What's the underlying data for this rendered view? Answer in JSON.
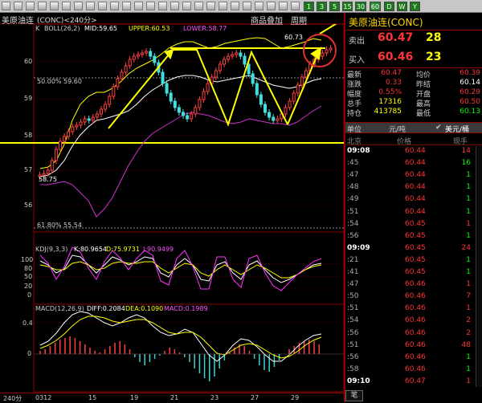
{
  "toolbar": {
    "period_buttons": [
      "1",
      "3",
      "5",
      "15",
      "30",
      "60",
      "D",
      "W",
      "Y"
    ]
  },
  "chart_header": {
    "symbol": "美原油连",
    "code_period": "(CONC)<240分>",
    "tab_overlay": "商品叠加",
    "tab_period": "周期"
  },
  "boll": {
    "label": "BOLL(26,2)",
    "prefix": "K",
    "mid": "MID:59.65",
    "upper": "UPPER:60.53",
    "lower": "LOWER:58.77",
    "colors": {
      "mid": "#ffffff",
      "upper": "#ffff00",
      "lower": "#ff55ff"
    }
  },
  "price_axis": [
    "60",
    "59",
    "58",
    "57",
    "56"
  ],
  "annotations": {
    "high": "60.73",
    "low": "58.75",
    "fib_50": "50.00% 59.60",
    "fib_618": "61.80% 55.54"
  },
  "kdj": {
    "label": "KDJ(9,3,3)",
    "k": "K:80.9654",
    "d": "D:75.9731",
    "j": "J:90.9499",
    "axis": [
      "100",
      "80",
      "50",
      "20",
      "0"
    ]
  },
  "macd": {
    "label": "MACD(12,26,9)",
    "diff": "DIFF:0.2084",
    "dea": "DEA:0.1090",
    "macd": "MACD:0.1989",
    "axis": [
      "0.4",
      "0"
    ]
  },
  "date_axis": {
    "period_label": "240分",
    "dates": [
      "0312",
      "15",
      "19",
      "21",
      "23",
      "27",
      "29"
    ]
  },
  "quote": {
    "title": "美原油连(CONC)",
    "ask_label": "卖出",
    "ask_price": "60.47",
    "ask_vol": "28",
    "bid_label": "买入",
    "bid_price": "60.46",
    "bid_vol": "23",
    "rows": [
      {
        "l1": "最新",
        "v1": "60.47",
        "c1": "#ff3333",
        "l2": "均价",
        "v2": "60.39",
        "c2": "#ff3333"
      },
      {
        "l1": "涨跌",
        "v1": "0.33",
        "c1": "#ff3333",
        "l2": "昨结",
        "v2": "60.14",
        "c2": "#ffffff"
      },
      {
        "l1": "幅度",
        "v1": "0.55%",
        "c1": "#ff3333",
        "l2": "开盘",
        "v2": "60.29",
        "c2": "#ff3333"
      },
      {
        "l1": "总手",
        "v1": "17316",
        "c1": "#ffff00",
        "l2": "最高",
        "v2": "60.50",
        "c2": "#ff3333"
      },
      {
        "l1": "持仓",
        "v1": "413785",
        "c1": "#ffff00",
        "l2": "最低",
        "v2": "60.13",
        "c2": "#00ff00"
      }
    ]
  },
  "unit_bar": {
    "label": "单位",
    "unit1": "元/吨",
    "unit2": "美元/桶"
  },
  "ticks": {
    "headers": [
      "北京",
      "价格",
      "现手"
    ],
    "rows": [
      {
        "time": "09:08",
        "price": "60.44",
        "vol": "14",
        "vc": "#ff3333",
        "bold": true
      },
      {
        "time": ":45",
        "price": "60.44",
        "vol": "16",
        "vc": "#00ff00",
        "bold": false
      },
      {
        "time": ":47",
        "price": "60.44",
        "vol": "1",
        "vc": "#00ff00",
        "bold": false
      },
      {
        "time": ":48",
        "price": "60.44",
        "vol": "1",
        "vc": "#00ff00",
        "bold": false
      },
      {
        "time": ":49",
        "price": "60.44",
        "vol": "1",
        "vc": "#00ff00",
        "bold": false
      },
      {
        "time": ":51",
        "price": "60.44",
        "vol": "1",
        "vc": "#00ff00",
        "bold": false
      },
      {
        "time": ":54",
        "price": "60.45",
        "vol": "1",
        "vc": "#ff3333",
        "bold": false
      },
      {
        "time": ":56",
        "price": "60.45",
        "vol": "1",
        "vc": "#00ff00",
        "bold": false
      },
      {
        "time": "09:09",
        "price": "60.45",
        "vol": "24",
        "vc": "#ff3333",
        "bold": true
      },
      {
        "time": ":21",
        "price": "60.45",
        "vol": "1",
        "vc": "#00ff00",
        "bold": false
      },
      {
        "time": ":41",
        "price": "60.45",
        "vol": "1",
        "vc": "#00ff00",
        "bold": false
      },
      {
        "time": ":47",
        "price": "60.46",
        "vol": "1",
        "vc": "#ff3333",
        "bold": false
      },
      {
        "time": ":50",
        "price": "60.46",
        "vol": "7",
        "vc": "#ff3333",
        "bold": false
      },
      {
        "time": ":51",
        "price": "60.46",
        "vol": "1",
        "vc": "#ff3333",
        "bold": false
      },
      {
        "time": ":54",
        "price": "60.46",
        "vol": "2",
        "vc": "#ff3333",
        "bold": false
      },
      {
        "time": ":56",
        "price": "60.46",
        "vol": "2",
        "vc": "#ff3333",
        "bold": false
      },
      {
        "time": ":51",
        "price": "60.46",
        "vol": "48",
        "vc": "#ff3333",
        "bold": false
      },
      {
        "time": ":56",
        "price": "60.46",
        "vol": "1",
        "vc": "#00ff00",
        "bold": false
      },
      {
        "time": ":58",
        "price": "60.46",
        "vol": "1",
        "vc": "#00ff00",
        "bold": false
      },
      {
        "time": "09:10",
        "price": "60.47",
        "vol": "1",
        "vc": "#ff3333",
        "bold": true
      }
    ],
    "bottom_tab": "笔"
  }
}
